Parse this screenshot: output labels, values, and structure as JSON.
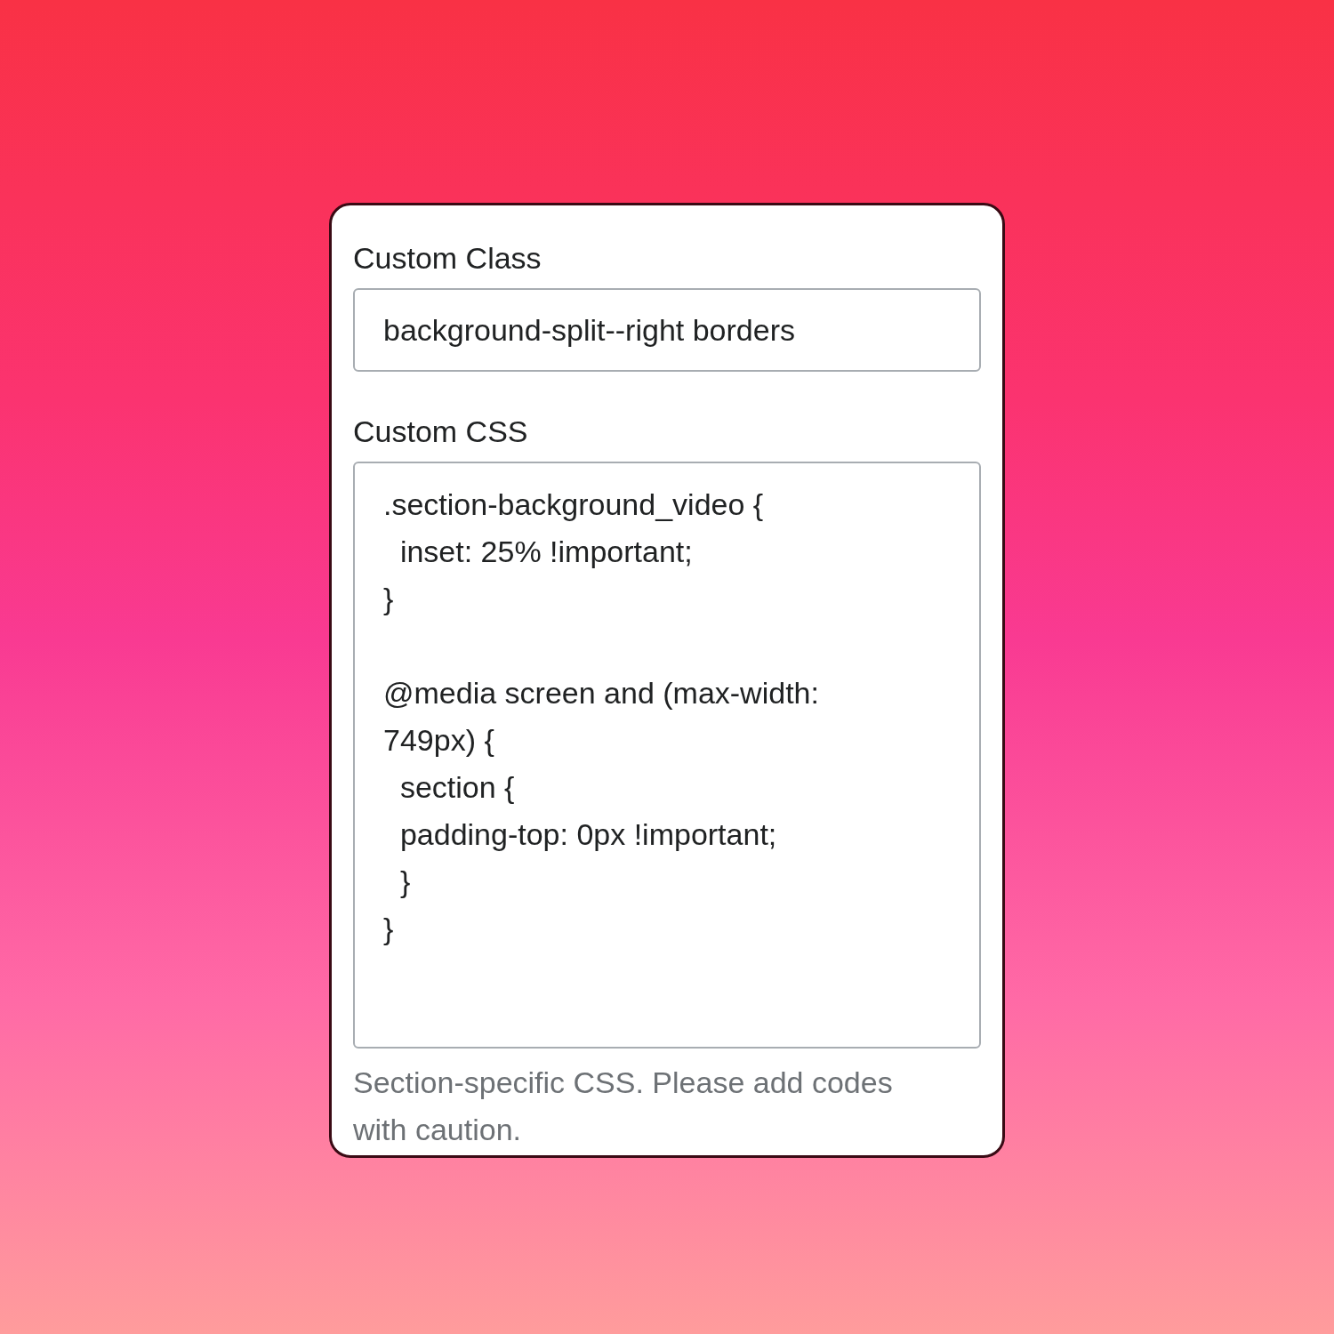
{
  "fields": [
    {
      "kind": "input",
      "label": "Custom Class",
      "value": "background-split--right borders"
    },
    {
      "kind": "textarea",
      "label": "Custom CSS",
      "value": ".section-background_video {\n  inset: 25% !important;\n}\n\n@media screen and (max-width: 749px) {\n  section {\n  padding-top: 0px !important;\n  }\n}",
      "help": "Section-specific CSS. Please add codes with caution."
    }
  ]
}
